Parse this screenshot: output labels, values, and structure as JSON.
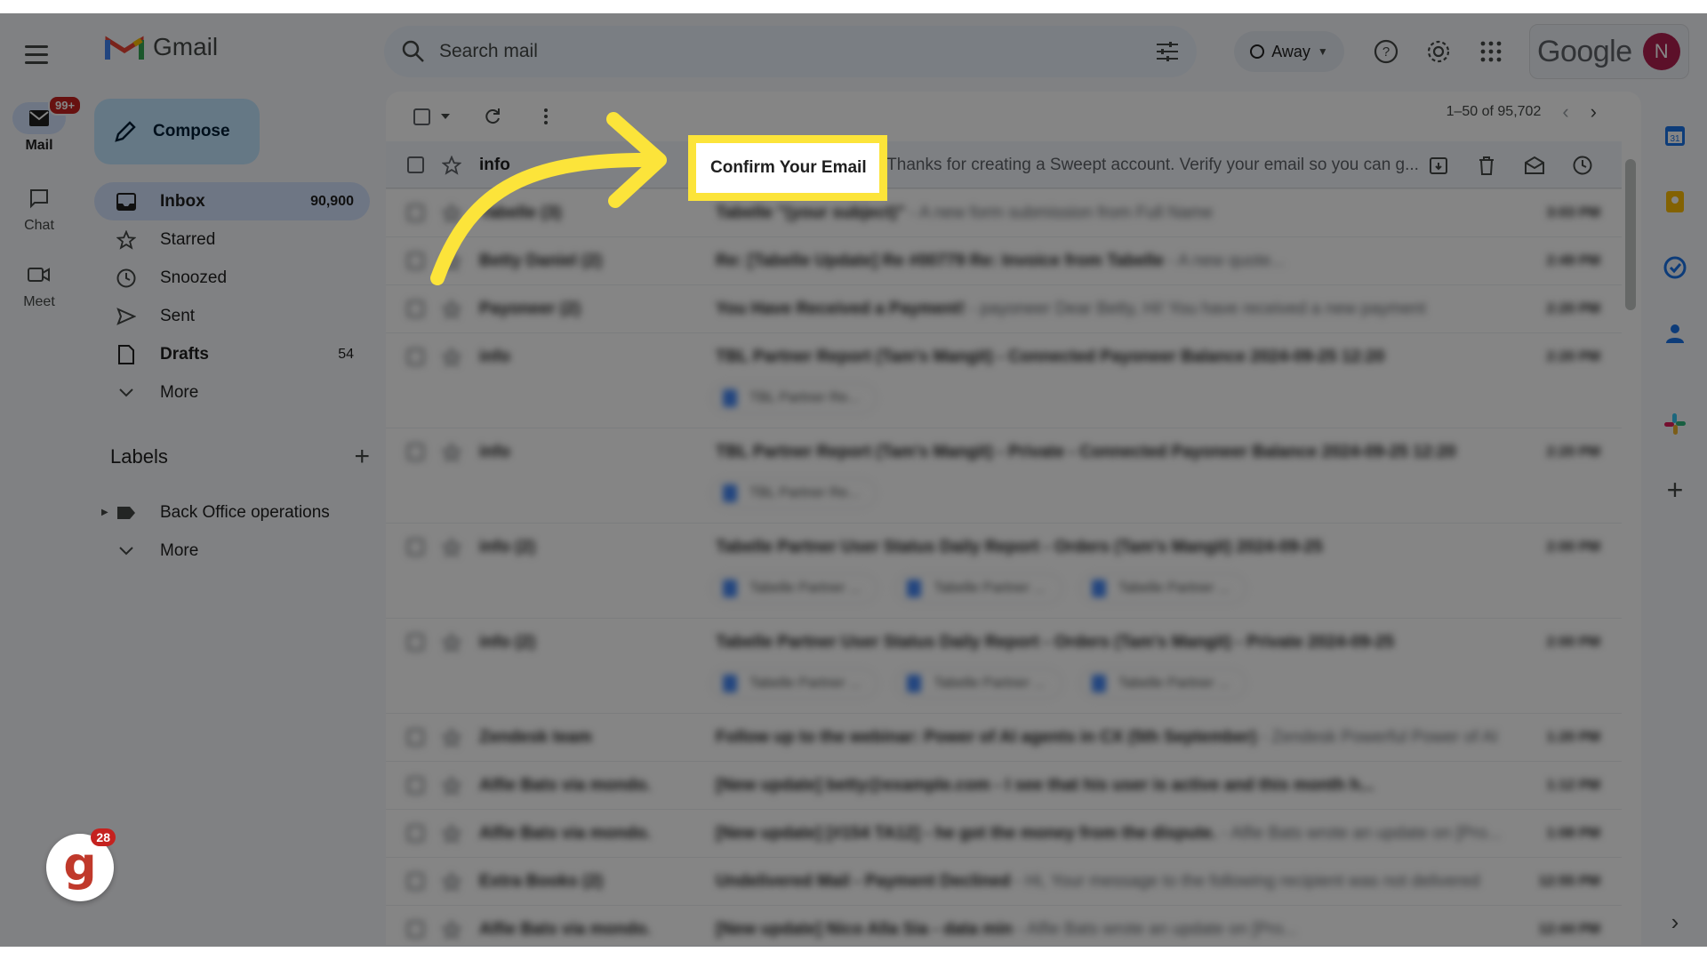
{
  "app": {
    "name": "Gmail",
    "brand_word": "Google",
    "avatar_initial": "N"
  },
  "rail": [
    {
      "label": "Mail",
      "badge": "99+"
    },
    {
      "label": "Chat"
    },
    {
      "label": "Meet"
    }
  ],
  "search": {
    "placeholder": "Search mail"
  },
  "status": {
    "label": "Away"
  },
  "compose": {
    "label": "Compose"
  },
  "nav": [
    {
      "label": "Inbox",
      "count": "90,900"
    },
    {
      "label": "Starred",
      "count": ""
    },
    {
      "label": "Snoozed",
      "count": ""
    },
    {
      "label": "Sent",
      "count": ""
    },
    {
      "label": "Drafts",
      "count": "54"
    },
    {
      "label": "More",
      "count": ""
    }
  ],
  "labels": {
    "heading": "Labels",
    "items": [
      {
        "label": "Back Office operations"
      },
      {
        "label": "More"
      }
    ]
  },
  "pager": {
    "range": "1–50 of 95,702"
  },
  "emails": [
    {
      "sender": "info",
      "subject": "Confirm Your Email",
      "preview": "- Thanks for creating a Sweept account. Verify your email so you can g..."
    },
    {
      "sender": "Tabelle (3)",
      "subject": "Tabelle \"(your subject)\"",
      "preview": "- A new form submission from Full Name",
      "time": "3:03 PM"
    },
    {
      "sender": "Betty Daniel (2)",
      "subject": "Re: [Tabelle Update] Re #00779 Re: Invoice from Tabelle",
      "preview": "- A new quote...",
      "time": "2:49 PM"
    },
    {
      "sender": "Payoneer (2)",
      "subject": "You Have Received a Payment!",
      "preview": "- payoneer Dear Betty, Hi! You have received a new payment",
      "time": "2:20 PM"
    },
    {
      "sender": "info",
      "subject": "TBL Partner Report (Tam's Mangit) - Connected Payoneer Balance 2024-09-25 12:20",
      "preview": "",
      "time": "2:20 PM",
      "chips": [
        "TBL Partner Re..."
      ]
    },
    {
      "sender": "info",
      "subject": "TBL Partner Report (Tam's Mangit) - Private - Connected Payoneer Balance 2024-09-25 12:20",
      "preview": "",
      "time": "2:20 PM",
      "chips": [
        "TBL Partner Re..."
      ]
    },
    {
      "sender": "info (2)",
      "subject": "Tabelle Partner User Status Daily Report - Orders (Tam's Mangit) 2024-09-25",
      "preview": "",
      "time": "2:00 PM",
      "chips": [
        "Tabelle Partner ...",
        "Tabelle Partner ...",
        "Tabelle Partner ..."
      ]
    },
    {
      "sender": "info (2)",
      "subject": "Tabelle Partner User Status Daily Report - Orders (Tam's Mangit) - Private 2024-09-25",
      "preview": "",
      "time": "2:00 PM",
      "chips": [
        "Tabelle Partner ...",
        "Tabelle Partner ...",
        "Tabelle Partner ..."
      ]
    },
    {
      "sender": "Zendesk team",
      "subject": "Follow up to the webinar: Power of AI agents in CX (5th September)",
      "preview": "- Zendesk Powerful Power of AI",
      "time": "1:20 PM"
    },
    {
      "sender": "Alfie Bats via mondo.",
      "subject": "[New update] betty@example.com - I see that his user is active and this month h...",
      "preview": "",
      "time": "1:12 PM"
    },
    {
      "sender": "Alfie Bats via mondo.",
      "subject": "[New update] [#154 TA12] - he got the money from the dispute.",
      "preview": "- Alfie Bats wrote an update on [Pro...",
      "time": "1:08 PM"
    },
    {
      "sender": "Extra Books (2)",
      "subject": "Undelivered Mail - Payment Declined",
      "preview": "- Hi, Your message to the following recipient was not delivered",
      "time": "12:55 PM"
    },
    {
      "sender": "Alfie Bats via mondo.",
      "subject": "[New update] Nico Alla Sia - data min",
      "preview": "- Alfie Bats wrote an update on [Pro...",
      "time": "12:44 PM"
    }
  ],
  "colors": {
    "highlight": "#fce43a",
    "accent": "#0b57d0",
    "dim_overlay": "rgba(0,0,0,0.48)"
  },
  "overlay": {
    "gbadge_letter": "g",
    "gbadge_count": "28"
  }
}
